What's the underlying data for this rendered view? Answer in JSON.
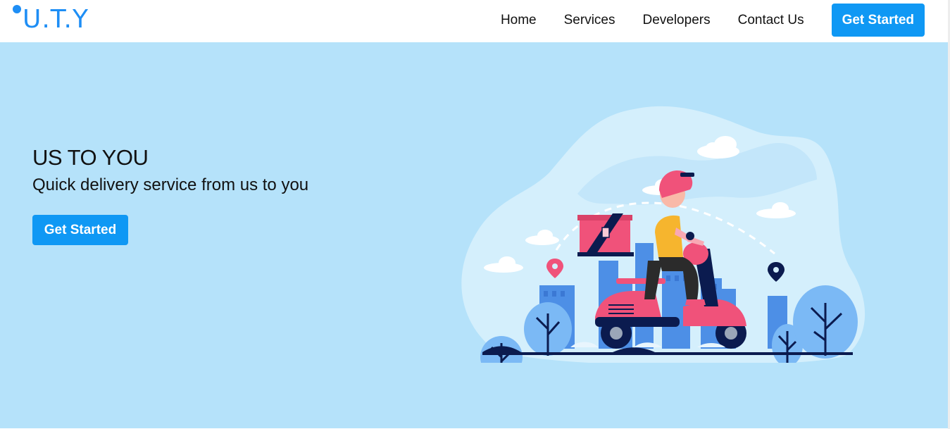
{
  "brand": {
    "logo_text": "U.T.Y"
  },
  "nav": {
    "links": [
      "Home",
      "Services",
      "Developers",
      "Contact Us"
    ],
    "cta_label": "Get Started"
  },
  "hero": {
    "title": "US TO YOU",
    "subtitle": "Quick delivery service from us to you",
    "cta_label": "Get Started"
  },
  "colors": {
    "accent": "#0f98f4",
    "hero_background": "#b5e2fa",
    "logo": "#1e8ef5"
  }
}
